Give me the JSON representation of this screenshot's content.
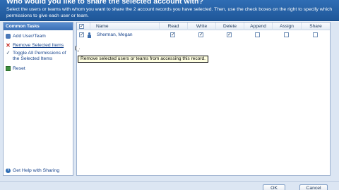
{
  "dialog": {
    "title": "Who would you like to share the selected account with?",
    "description": "Select the users or teams with whom you want to share the 2 account records you have selected. Then, use the check boxes on the right to specify which permissions to give each user or team."
  },
  "common_tasks": {
    "header": "Common Tasks",
    "items": [
      {
        "label": "Add User/Team",
        "icon": "add-user-icon"
      },
      {
        "label": "Remove Selected Items",
        "icon": "remove-x-icon"
      },
      {
        "label": "Toggle All Permissions of the Selected Items",
        "icon": "check-icon"
      },
      {
        "label": "Reset",
        "icon": "reset-icon"
      }
    ],
    "help": {
      "label": "Get Help with Sharing",
      "icon": "help-icon"
    }
  },
  "tooltip": "Remove selected users or teams from accessing this record.",
  "grid": {
    "columns": [
      "Name",
      "Read",
      "Write",
      "Delete",
      "Append",
      "Assign",
      "Share"
    ],
    "header_checkbox": "checked",
    "rows": [
      {
        "selected": true,
        "name": "Sherman, Megan",
        "permissions": {
          "Read": true,
          "Write": true,
          "Delete": true,
          "Append": false,
          "Assign": false,
          "Share": false
        }
      }
    ]
  },
  "buttons": {
    "ok": "OK",
    "cancel": "Cancel"
  },
  "colors": {
    "header_blue": "#2f6db4",
    "panel_bg": "#dce6f3",
    "tooltip_bg": "#ffffe1",
    "remove_red": "#c4261d"
  }
}
